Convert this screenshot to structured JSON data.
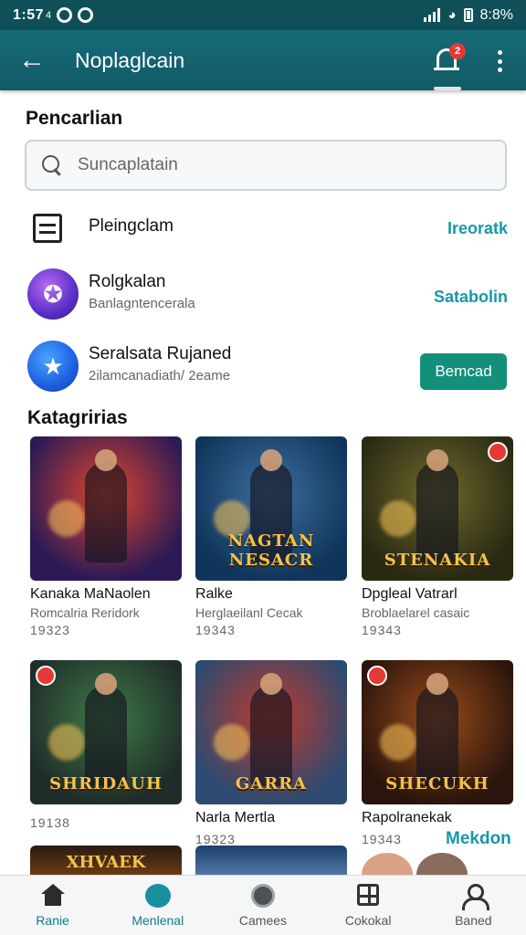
{
  "status_bar": {
    "time": "1:57",
    "time_suffix": "4",
    "battery": "8:8%"
  },
  "app_bar": {
    "title": "Noplaglcain",
    "notification_count": "2"
  },
  "search": {
    "title": "Pencarlian",
    "placeholder": "Suncaplatain"
  },
  "rows": [
    {
      "name": "Pleingclam",
      "action": "Ireoratk",
      "icon": "list-icon"
    },
    {
      "name": "Rolgkalan",
      "sub": "Banlagntencerala",
      "action": "Satabolin",
      "icon": "purple-app-icon"
    },
    {
      "name": "Seralsata Rujaned",
      "sub": "2ilamcanadiath/ 2eame",
      "button": "Bemcad",
      "icon": "star-app-icon"
    }
  ],
  "categories": {
    "title": "Katagririas",
    "items": [
      {
        "title": "Kanaka MaNaolen",
        "sub": "Romcalria Reridork",
        "count": "19323",
        "art_text": "",
        "palette": [
          "#2b1a55",
          "#e2452c"
        ]
      },
      {
        "title": "Ralke",
        "sub": "Herglaeilanl Cecak",
        "count": "19343",
        "art_text": "NAGTAN NESACR",
        "palette": [
          "#10355a",
          "#3d6fa0"
        ]
      },
      {
        "title": "Dpgleal Vatrarl",
        "sub": "Broblaelarel casaic",
        "count": "19343",
        "art_text": "STENAKIA",
        "palette": [
          "#2a2a14",
          "#6e6a2a"
        ]
      },
      {
        "title": "",
        "sub": "",
        "count": "19138",
        "art_text": "SHRIDAUH",
        "palette": [
          "#1f2d2a",
          "#3f7a45"
        ]
      },
      {
        "title": "Narla Mertla",
        "sub": "",
        "count": "19323",
        "art_text": "GARRA",
        "palette": [
          "#2d4a70",
          "#c0392b"
        ]
      },
      {
        "title": "Rapolranekak",
        "sub": "",
        "count": "19343",
        "art_text": "SHECUKH",
        "palette": [
          "#2a150c",
          "#9a4b1c"
        ]
      }
    ],
    "partial_art_text": "XHVAEK",
    "more": "Mekdon"
  },
  "bottom_nav": [
    {
      "label": "Ranie",
      "icon": "home-icon",
      "active": false
    },
    {
      "label": "Menlenal",
      "icon": "chat-bubble-icon",
      "active": true
    },
    {
      "label": "Camees",
      "icon": "disc-icon",
      "active": false
    },
    {
      "label": "Cokokal",
      "icon": "grid-icon",
      "active": false
    },
    {
      "label": "Baned",
      "icon": "profile-icon",
      "active": false
    }
  ],
  "colors": {
    "app_bar": "#176a77",
    "accent": "#1798a8",
    "button": "#138f7a",
    "badge": "#e53935"
  }
}
